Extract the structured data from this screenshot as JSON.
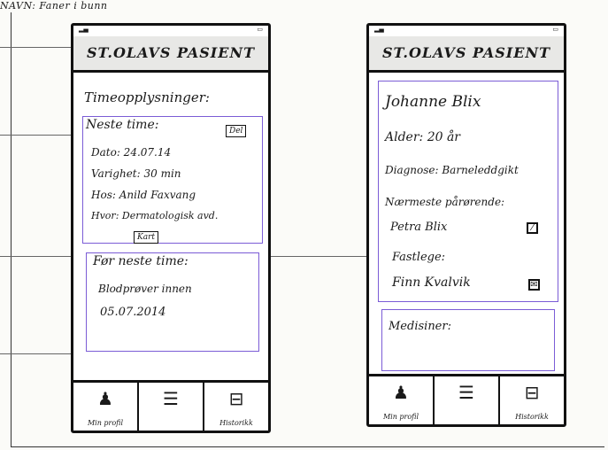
{
  "sheet_label": "NAVN: Faner i bunn",
  "app_title": "ST.OLAVS PASIENT",
  "tabs": [
    {
      "label": "Min profil",
      "icon": "person-icon"
    },
    {
      "label": "",
      "icon": "list-icon"
    },
    {
      "label": "Historikk",
      "icon": "archive-icon"
    }
  ],
  "left_phone": {
    "section_title": "Timeopplysninger:",
    "next_title": "Neste time:",
    "share_button": "Del",
    "lines": [
      "Dato: 24.07.14",
      "Varighet: 30 min",
      "Hos: Anild Faxvang",
      "Hvor: Dermatologisk avd."
    ],
    "map_button": "Kart",
    "before_title": "Før neste time:",
    "before_lines": [
      "Blodprøver innen",
      "05.07.2014"
    ]
  },
  "right_phone": {
    "name": "Johanne Blix",
    "age": "Alder: 20 år",
    "diagnosis": "Diagnose: Barneleddgikt",
    "relatives_title": "Nærmeste pårørende:",
    "relative": "Petra Blix",
    "gp_title": "Fastlege:",
    "gp": "Finn Kvalvik",
    "medicines_title": "Medisiner:"
  },
  "colors": {
    "accent": "#7b5cd6",
    "ink": "#111111",
    "header_bg": "#e8e8e6"
  }
}
